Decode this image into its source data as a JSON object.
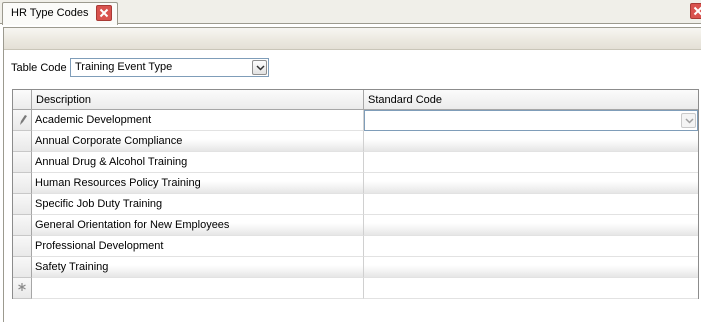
{
  "tab": {
    "title": "HR Type Codes",
    "close_icon": "close-icon"
  },
  "window": {
    "close_icon": "close-icon"
  },
  "filter": {
    "label": "Table Code",
    "value": "Training Event Type"
  },
  "grid": {
    "columns": [
      "Description",
      "Standard Code"
    ],
    "rows": [
      {
        "description": "Academic Development",
        "standard_code": ""
      },
      {
        "description": "Annual Corporate Compliance",
        "standard_code": ""
      },
      {
        "description": "Annual Drug & Alcohol Training",
        "standard_code": ""
      },
      {
        "description": "Human Resources Policy Training",
        "standard_code": ""
      },
      {
        "description": "Specific Job Duty Training",
        "standard_code": ""
      },
      {
        "description": "General Orientation for New Employees",
        "standard_code": ""
      },
      {
        "description": "Professional Development",
        "standard_code": ""
      },
      {
        "description": "Safety Training",
        "standard_code": ""
      }
    ],
    "edit_row_icon": "pencil-icon",
    "new_row_icon": "asterisk-icon"
  },
  "colors": {
    "close_red": "#d9534f",
    "border": "#7f9db9",
    "alt_row": "#e6e6e6"
  }
}
